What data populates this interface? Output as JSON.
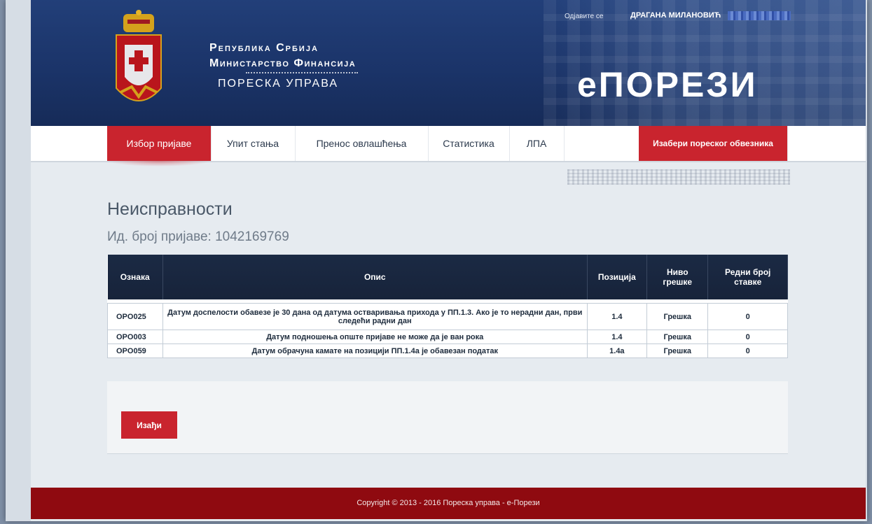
{
  "header": {
    "ministry_line1": "Република Србија",
    "ministry_line2": "Министарство Финансија",
    "ministry_line3": "ПОРЕСКА УПРАВА",
    "logo": "еПОРЕЗИ",
    "logout": "Одјавите се",
    "user": "ДРАГАНА МИЛАНОВИЋ"
  },
  "nav": {
    "items": [
      "Избор пријаве",
      "Упит стања",
      "Пренос овлашћења",
      "Статистика",
      "ЛПА"
    ],
    "right_button": "Изабери пореског обвезника"
  },
  "page": {
    "title": "Неисправности",
    "subtitle_label": "Ид. број пријаве:",
    "subtitle_value": "1042169769"
  },
  "table": {
    "headers": [
      "Ознака",
      "Опис",
      "Позиција",
      "Ниво грешке",
      "Редни број ставке"
    ],
    "rows": [
      {
        "code": "OPO025",
        "desc": "Датум доспелости обавезе је 30 дана од датума остваривања прихода у ПП.1.3. Ако је то нерадни дан, први следећи радни дан",
        "pos": "1.4",
        "level": "Грешка",
        "idx": "0"
      },
      {
        "code": "OPO003",
        "desc": "Датум подношења опште пријаве не може да је ван рока",
        "pos": "1.4",
        "level": "Грешка",
        "idx": "0"
      },
      {
        "code": "OPO059",
        "desc": "Датум обрачуна камате на позицији ПП.1.4а је обавезан податак",
        "pos": "1.4а",
        "level": "Грешка",
        "idx": "0"
      }
    ]
  },
  "actions": {
    "exit": "Изађи"
  },
  "footer": {
    "copyright": "Copyright © 2013 - 2016 Пореска управа - е-Порези"
  },
  "colors": {
    "accent": "#c9242e",
    "header": "#1b3469",
    "footer": "#8f0a10",
    "table_head": "#1b2a44"
  }
}
